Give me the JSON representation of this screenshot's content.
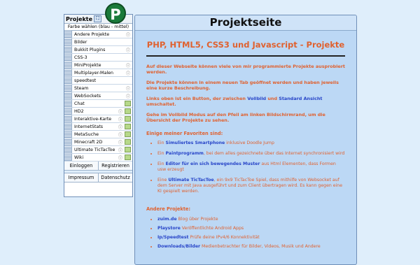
{
  "sidebar": {
    "title": "Projekte",
    "color_toggle": "Farbe wählen (blau - mittel)",
    "items": [
      {
        "label": "Andere Projekte",
        "icon": "info"
      },
      {
        "label": "Bilder",
        "icon": ""
      },
      {
        "label": "Bukkit Plugins",
        "icon": "info"
      },
      {
        "label": "CSS-3",
        "icon": ""
      },
      {
        "label": "MiniProjekte",
        "icon": "info"
      },
      {
        "label": "Multiplayer-Malen",
        "icon": "info"
      },
      {
        "label": "speedtest",
        "icon": ""
      },
      {
        "label": "Steam",
        "icon": "info"
      },
      {
        "label": "WebSockets",
        "icon": "info"
      },
      {
        "label": "Chat",
        "icon": "image"
      },
      {
        "label": "HD2",
        "icon": "info-image"
      },
      {
        "label": "Interaktive-Karte",
        "icon": "info-image"
      },
      {
        "label": "InternetStats",
        "icon": "info-image"
      },
      {
        "label": "MetaSuche",
        "icon": "info-image"
      },
      {
        "label": "Minecraft 2D",
        "icon": "info-image"
      },
      {
        "label": "Ultimate TicTacToe",
        "icon": "info-image"
      },
      {
        "label": "Wiki",
        "icon": "info-image"
      }
    ],
    "login": "Einloggen",
    "register": "Registrieren",
    "impressum": "Impressum",
    "datenschutz": "Datenschutz"
  },
  "logo_letter": "P",
  "main": {
    "title": "Projektseite",
    "heading": "PHP, HTML5, CSS3 und Javascript - Projekte",
    "p1": "Auf dieser Webseite können viele von mir programmierte Projekte ausprobiert werden.",
    "p2": "Die Projekte können in einem neuen Tab geöffnet werden und haben jeweils eine kurze Beschreibung.",
    "p3_a": "Links oben ist ein Button, der zwischen ",
    "p3_vollbild": "Vollbild",
    "p3_b": " und ",
    "p3_standard": "Standard Ansicht",
    "p3_c": " umschaltet.",
    "p4": "Gehe im Vollbild Modus auf den Pfeil am linken Bildschirmrand, um die Übersicht der Projekte zu sehen.",
    "favorites_heading": "Einige meiner Favoriten sind:",
    "favorites": [
      {
        "pre": "Ein ",
        "bold": "Simuliertes Smartphone",
        "post": " inklusive Doodle Jump"
      },
      {
        "pre": "Ein ",
        "bold": "Paintprogramm",
        "post": ", bei dem alles gezeichnete über das Internet synchronisiert wird"
      },
      {
        "pre": "Ein ",
        "bold": "Editor für ein sich bewegendes Muster",
        "post": " aus Html Elementen, dass Formen usw erzeugt"
      },
      {
        "pre": "Eine ",
        "bold": "Ultimate TicTacToe",
        "post": ", ein 9x9 TicTacToe Spiel, dass mithilfe von Websocket auf dem Server mit Java ausgeführt und zum Client übertragen wird. Es kann gegen eine KI gespielt werden."
      }
    ],
    "other_heading": "Andere Projekte:",
    "others": [
      {
        "bold": "zuim.de",
        "post": " Blog über Projekte"
      },
      {
        "bold": "Playstore",
        "post": " Veröffentlichte Android Apps"
      },
      {
        "bold": "Ip/Speedtest",
        "post": " Prüfe deine IPv4/6 Konnektivität"
      },
      {
        "bold": "Downloads/Bilder",
        "post": " Medienbetrachter für Bilder, Videos, Musik und Andere"
      }
    ]
  },
  "colors": {
    "background": "#dfeefb",
    "panel": "#bcd8f5",
    "accent_orange": "#e0612f",
    "accent_blue": "#2845c8",
    "logo_green": "#1a7a3a"
  }
}
